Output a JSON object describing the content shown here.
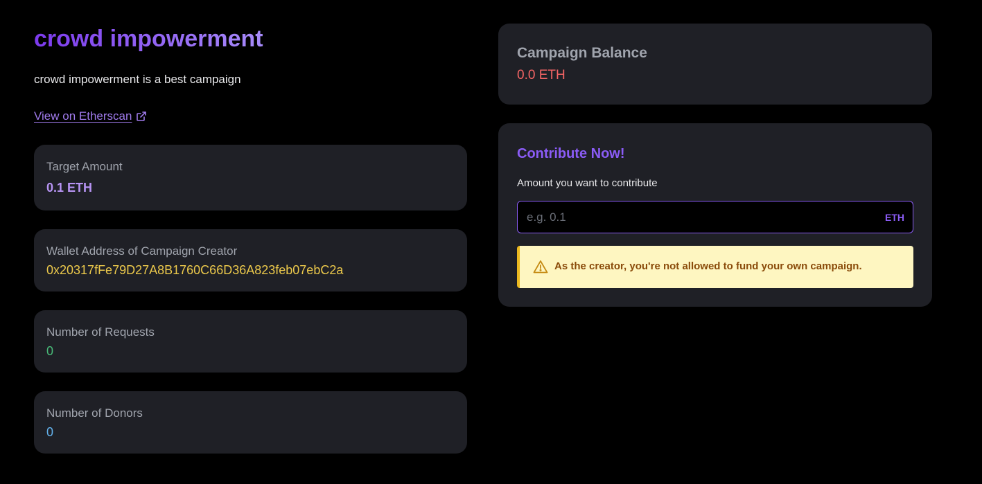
{
  "campaign": {
    "title": "crowd impowerment",
    "description": "crowd impowerment is a best campaign",
    "etherscan_link_label": "View on Etherscan"
  },
  "stats": [
    {
      "label": "Target Amount",
      "value": "0.1 ETH",
      "color": "#b794f4"
    },
    {
      "label": "Wallet Address of Campaign Creator",
      "value": "0x20317fFe79D27A8B1760C66D36A823feb07ebC2a",
      "color": "#ecc94b"
    },
    {
      "label": "Number of Requests",
      "value": "0",
      "color": "#48bb78"
    },
    {
      "label": "Number of Donors",
      "value": "0",
      "color": "#63b3ed"
    }
  ],
  "balance": {
    "label": "Campaign Balance",
    "value": "0.0 ETH"
  },
  "contribute": {
    "title": "Contribute Now!",
    "amount_label": "Amount you want to contribute",
    "amount_placeholder": "e.g. 0.1",
    "amount_value": "",
    "unit": "ETH",
    "warning": "As the creator, you're not allowed to fund your own campaign."
  },
  "colors": {
    "accent": "#8b5cf6",
    "title_gradient_start": "#7c3aed",
    "title_gradient_end": "#a78bfa",
    "card_bg": "#1f2026",
    "balance_value": "#f56565",
    "warning_bg": "#fef6c1",
    "warning_border": "#ecb91f",
    "warning_text": "#8a4b0a"
  },
  "icons": {
    "external_link": "external-link-icon",
    "warning": "warning-triangle-icon"
  }
}
